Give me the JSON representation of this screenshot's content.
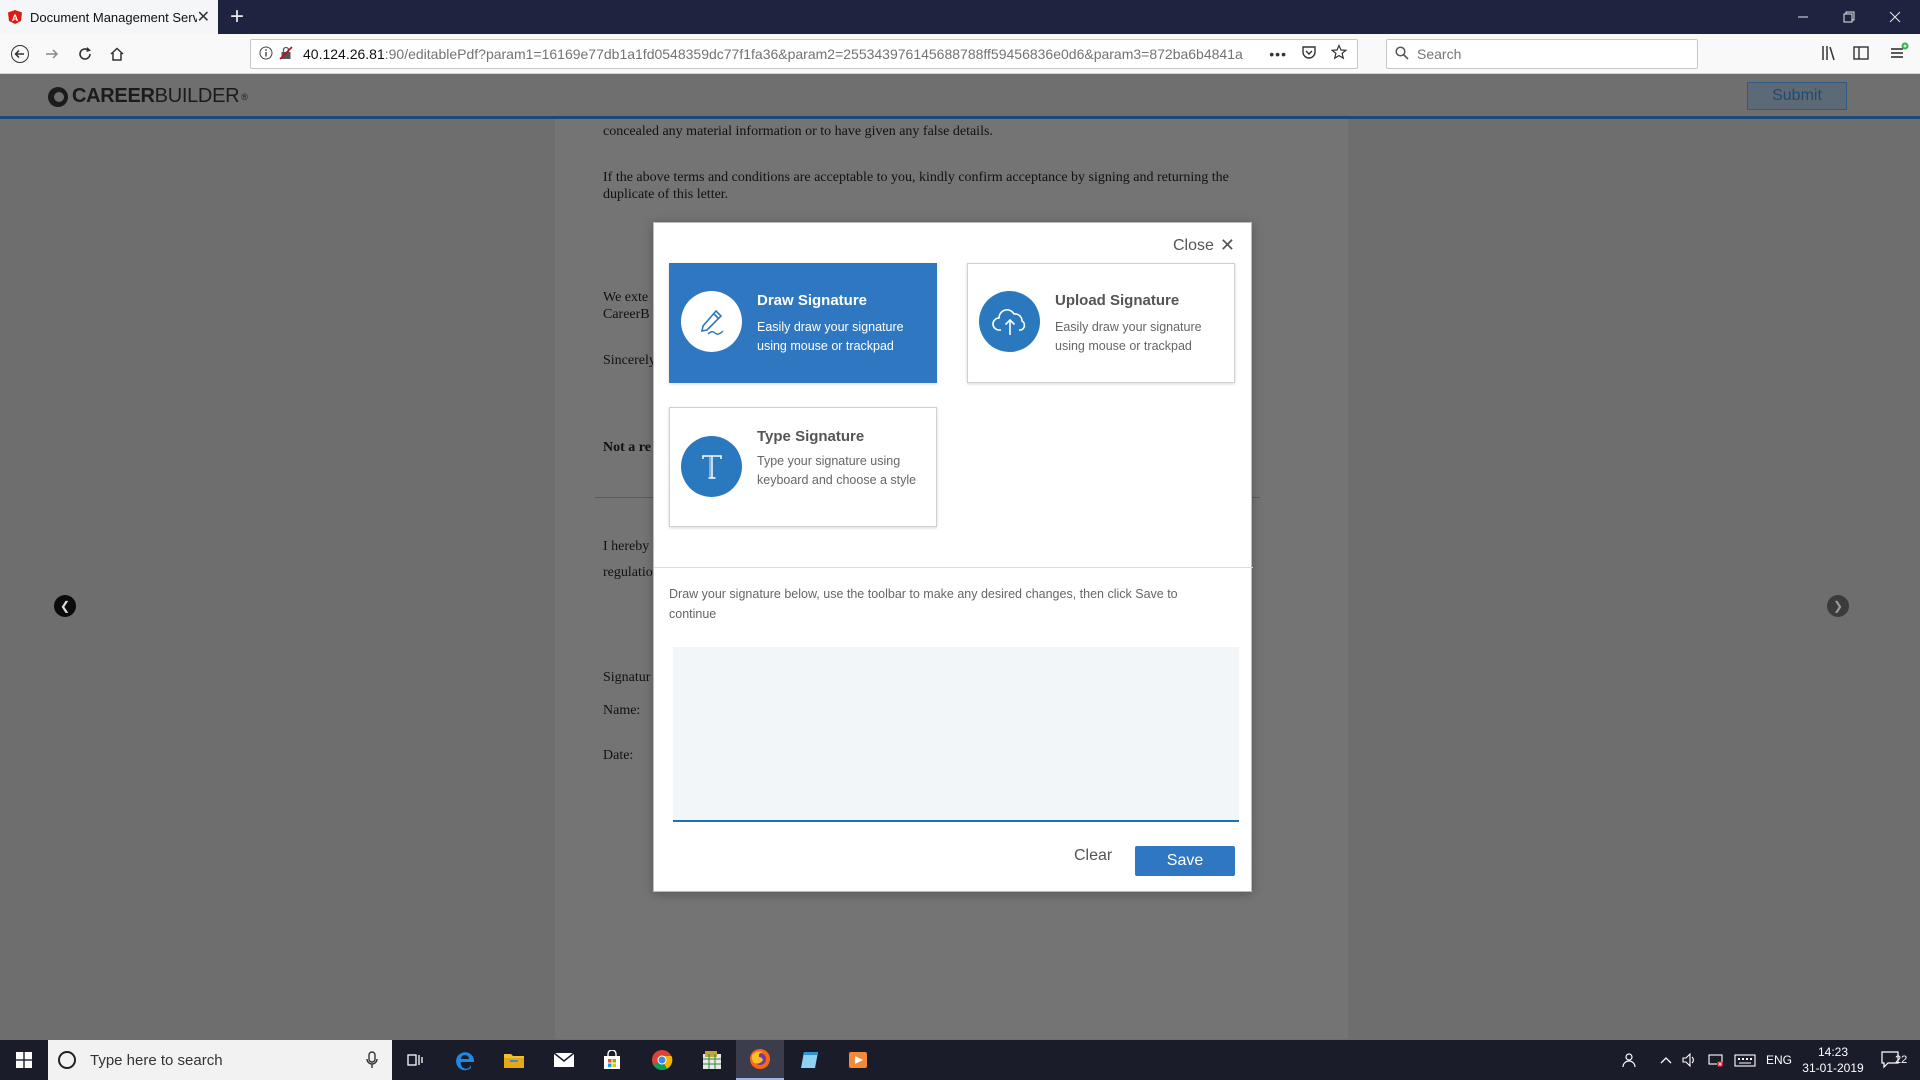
{
  "browser": {
    "tab_title": "Document Management Servic",
    "url_host": "40.124.26.81",
    "url_rest": ":90/editablePdf?param1=16169e77db1a1fd0548359dc77f1fa36&param2=255343976145688788ff59456836e0d6&param3=872ba6b4841a",
    "search_placeholder": "Search",
    "url_menu": "•••"
  },
  "site": {
    "logo_bold": "CAREER",
    "logo_regular": "BUILDER",
    "logo_reg": "®",
    "submit_label": "Submit"
  },
  "document": {
    "line1": "concealed any material information or to have given any false details.",
    "line2": "If the above terms and conditions are acceptable to you, kindly confirm acceptance by signing and returning the duplicate of this letter.",
    "line3": "We exte",
    "line3b": "CareerB",
    "line4": "Sincerely",
    "line5": "Not a re",
    "line6": "I hereby",
    "line6b": "regulatio",
    "sig_label": "Signatur",
    "name_label": "Name:",
    "date_label": "Date:"
  },
  "modal": {
    "close_label": "Close",
    "options": [
      {
        "title": "Draw Signature",
        "description": "Easily draw your signature using mouse or trackpad",
        "icon": "pen-icon",
        "active": true
      },
      {
        "title": "Upload Signature",
        "description": "Easily draw your signature using mouse or trackpad",
        "icon": "cloud-upload-icon",
        "active": false
      },
      {
        "title": "Type Signature",
        "description": "Type your signature using keyboard and choose a style",
        "icon": "type-text-icon",
        "active": false
      }
    ],
    "instructions": "Draw your signature below, use the toolbar to make any desired changes, then click Save to continue",
    "clear_label": "Clear",
    "save_label": "Save",
    "accent_color": "#2f78c1"
  },
  "taskbar": {
    "search_placeholder": "Type here to search",
    "language": "ENG",
    "time": "14:23",
    "date": "31-01-2019",
    "notification_count": "22"
  }
}
